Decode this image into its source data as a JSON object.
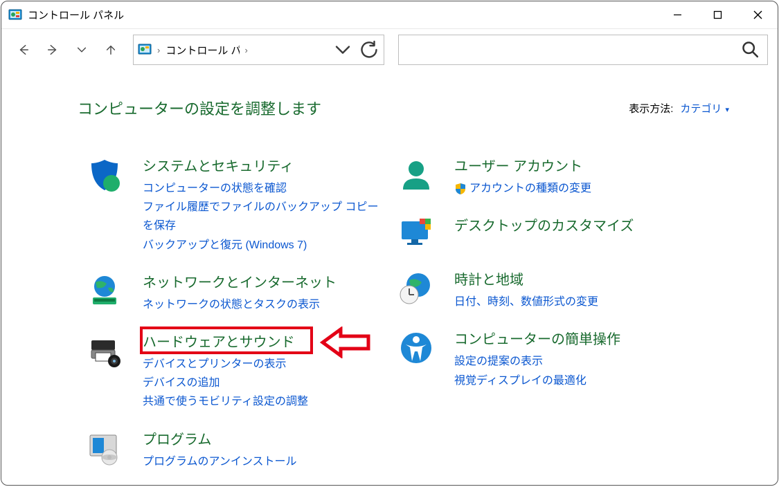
{
  "window": {
    "title": "コントロール パネル"
  },
  "address": {
    "text": "コントロール パネ...",
    "sep1": "›",
    "sep2": "›"
  },
  "search": {
    "placeholder": ""
  },
  "heading": "コンピューターの設定を調整します",
  "viewBy": {
    "label": "表示方法:",
    "value": "カテゴリ"
  },
  "left": {
    "system": {
      "title": "システムとセキュリティ",
      "l1": "コンピューターの状態を確認",
      "l2": "ファイル履歴でファイルのバックアップ コピーを保存",
      "l3": "バックアップと復元 (Windows 7)"
    },
    "network": {
      "title": "ネットワークとインターネット",
      "l1": "ネットワークの状態とタスクの表示"
    },
    "hardware": {
      "title": "ハードウェアとサウンド",
      "l1": "デバイスとプリンターの表示",
      "l2": "デバイスの追加",
      "l3": "共通で使うモビリティ設定の調整"
    },
    "programs": {
      "title": "プログラム",
      "l1": "プログラムのアンインストール"
    }
  },
  "right": {
    "users": {
      "title": "ユーザー アカウント",
      "l1": "アカウントの種類の変更"
    },
    "appearance": {
      "title": "デスクトップのカスタマイズ"
    },
    "clock": {
      "title": "時計と地域",
      "l1": "日付、時刻、数値形式の変更"
    },
    "ease": {
      "title": "コンピューターの簡単操作",
      "l1": "設定の提案の表示",
      "l2": "視覚ディスプレイの最適化"
    }
  }
}
